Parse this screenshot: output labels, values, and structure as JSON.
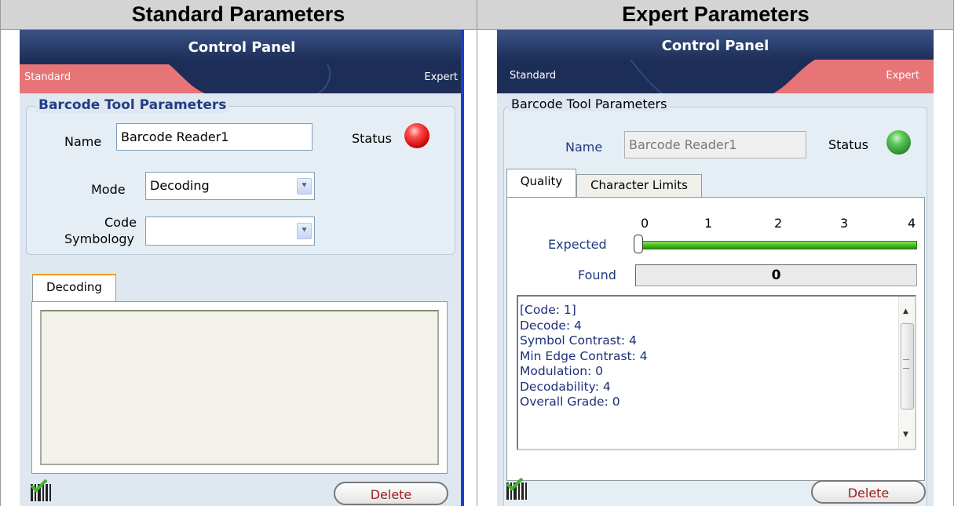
{
  "headers": {
    "standard": "Standard Parameters",
    "expert": "Expert Parameters"
  },
  "standard_panel": {
    "title": "Control Panel",
    "tab_standard": "Standard",
    "tab_expert": "Expert",
    "group_title": "Barcode Tool Parameters",
    "name_label": "Name",
    "name_value": "Barcode Reader1",
    "status_label": "Status",
    "status_color": "#e02020",
    "mode_label": "Mode",
    "mode_value": "Decoding",
    "symbology_label_1": "Code",
    "symbology_label_2": "Symbology",
    "symbology_value": "",
    "decoding_tab": "Decoding",
    "delete_label": "Delete"
  },
  "expert_panel": {
    "title": "Control Panel",
    "tab_standard": "Standard",
    "tab_expert": "Expert",
    "group_title": "Barcode Tool Parameters",
    "name_label": "Name",
    "name_value": "Barcode Reader1",
    "status_label": "Status",
    "status_color": "#3aa63a",
    "tab_quality": "Quality",
    "tab_character_limits": "Character Limits",
    "scale": [
      "0",
      "1",
      "2",
      "3",
      "4"
    ],
    "expected_label": "Expected",
    "expected_value": 0,
    "found_label": "Found",
    "found_value": "0",
    "results": [
      "[Code: 1]",
      "Decode: 4",
      "Symbol Contrast: 4",
      "Min Edge Contrast: 4",
      "Modulation: 0",
      "Decodability: 4",
      "Overall Grade: 0"
    ],
    "delete_label": "Delete"
  },
  "colors": {
    "accent_tab": "#e77476",
    "panel_bg": "#dfe8f0",
    "title_bar": "#1c2d57",
    "slider_green": "#46c21c"
  }
}
